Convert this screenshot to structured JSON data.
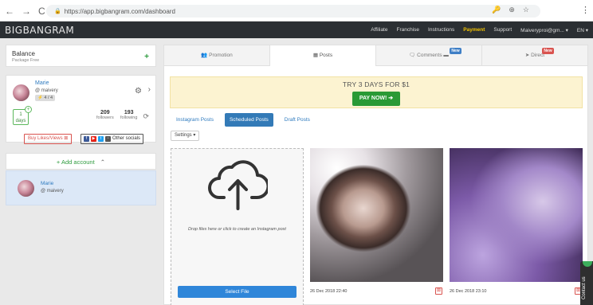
{
  "browser": {
    "back_icon": "←",
    "forward_icon": "→",
    "reload_icon": "C",
    "url": "https://app.bigbangram.com/dashboard",
    "lock_icon": "🔒",
    "key_icon": "🔑",
    "zoom_icon": "⊕",
    "star_icon": "☆",
    "menu_icon": "⋮"
  },
  "header": {
    "logo": "BIGBANGRAM",
    "nav": [
      "Affiliate",
      "Franchise",
      "Instructions",
      "Payment",
      "Support",
      "Maiveryproi@gm... ▾",
      "EN ▾"
    ]
  },
  "sidebar": {
    "balance_title": "Balance",
    "balance_sub": "Package Free",
    "balance_plus": "+",
    "profile": {
      "name": "Marie",
      "username": "@ maivery",
      "badge": "⚡ 4 / 4",
      "gear": "⚙",
      "chevron": "›",
      "days_num": "1",
      "days_label": "days",
      "days_plus": "+",
      "followers_count": "209",
      "followers_label": "followers",
      "following_count": "193",
      "following_label": "following",
      "refresh": "⟳",
      "buy_label": "Buy Likes/Views ⊠",
      "socials_label": "Other socials"
    },
    "add_account": "+ Add account",
    "add_chevron": "⌃",
    "account": {
      "name": "Marie",
      "username": "@ maivery"
    }
  },
  "tabs": [
    {
      "label": "👥 Promotion",
      "badge": ""
    },
    {
      "label": "▦ Posts",
      "badge": ""
    },
    {
      "label": "🗨 Comments ▬",
      "badge": "New"
    },
    {
      "label": "➤ Direct",
      "badge": "New"
    }
  ],
  "promo": {
    "text": "TRY 3 DAYS FOR $1",
    "button": "PAY NOW! ➔"
  },
  "subtabs": [
    "Instagram Posts",
    "Scheduled Posts",
    "Draft Posts"
  ],
  "settings_label": "Settings ▾",
  "dropzone": {
    "text": "Drop files here or click to create an Instagram post",
    "button": "Select File"
  },
  "posts": [
    {
      "date": "26 Dec 2018 22:40"
    },
    {
      "date": "26 Dec 2018 23:10"
    }
  ],
  "contact": "Contact us"
}
